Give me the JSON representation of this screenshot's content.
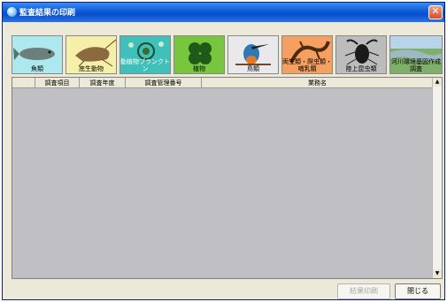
{
  "window": {
    "title": "監査結果の印刷"
  },
  "categories": [
    {
      "label": "魚類",
      "icon": "fish-icon",
      "bg": "#aee8ef"
    },
    {
      "label": "底生動物",
      "icon": "shrimp-icon",
      "bg": "#f6efa8"
    },
    {
      "label": "動植物プランクトン",
      "icon": "plankton-icon",
      "bg": "#3fc0ba"
    },
    {
      "label": "植物",
      "icon": "plant-icon",
      "bg": "#78c63d"
    },
    {
      "label": "鳥類",
      "icon": "kingfisher-icon",
      "bg": "#e9e9ec"
    },
    {
      "label": "両生類・爬虫類・哺乳類",
      "icon": "salamander-icon",
      "bg": "#f5a060"
    },
    {
      "label": "陸上昆虫類",
      "icon": "beetle-icon",
      "bg": "#bcbcbc"
    },
    {
      "label": "河川環境基図作成調査",
      "icon": "river-photo-icon",
      "bg": "#7fb06a"
    }
  ],
  "table": {
    "columns": [
      "",
      "調査項目",
      "調査年度",
      "調査管理番号",
      "業務名"
    ],
    "rows": []
  },
  "buttons": {
    "print": "結果印刷",
    "close": "閉じる"
  }
}
